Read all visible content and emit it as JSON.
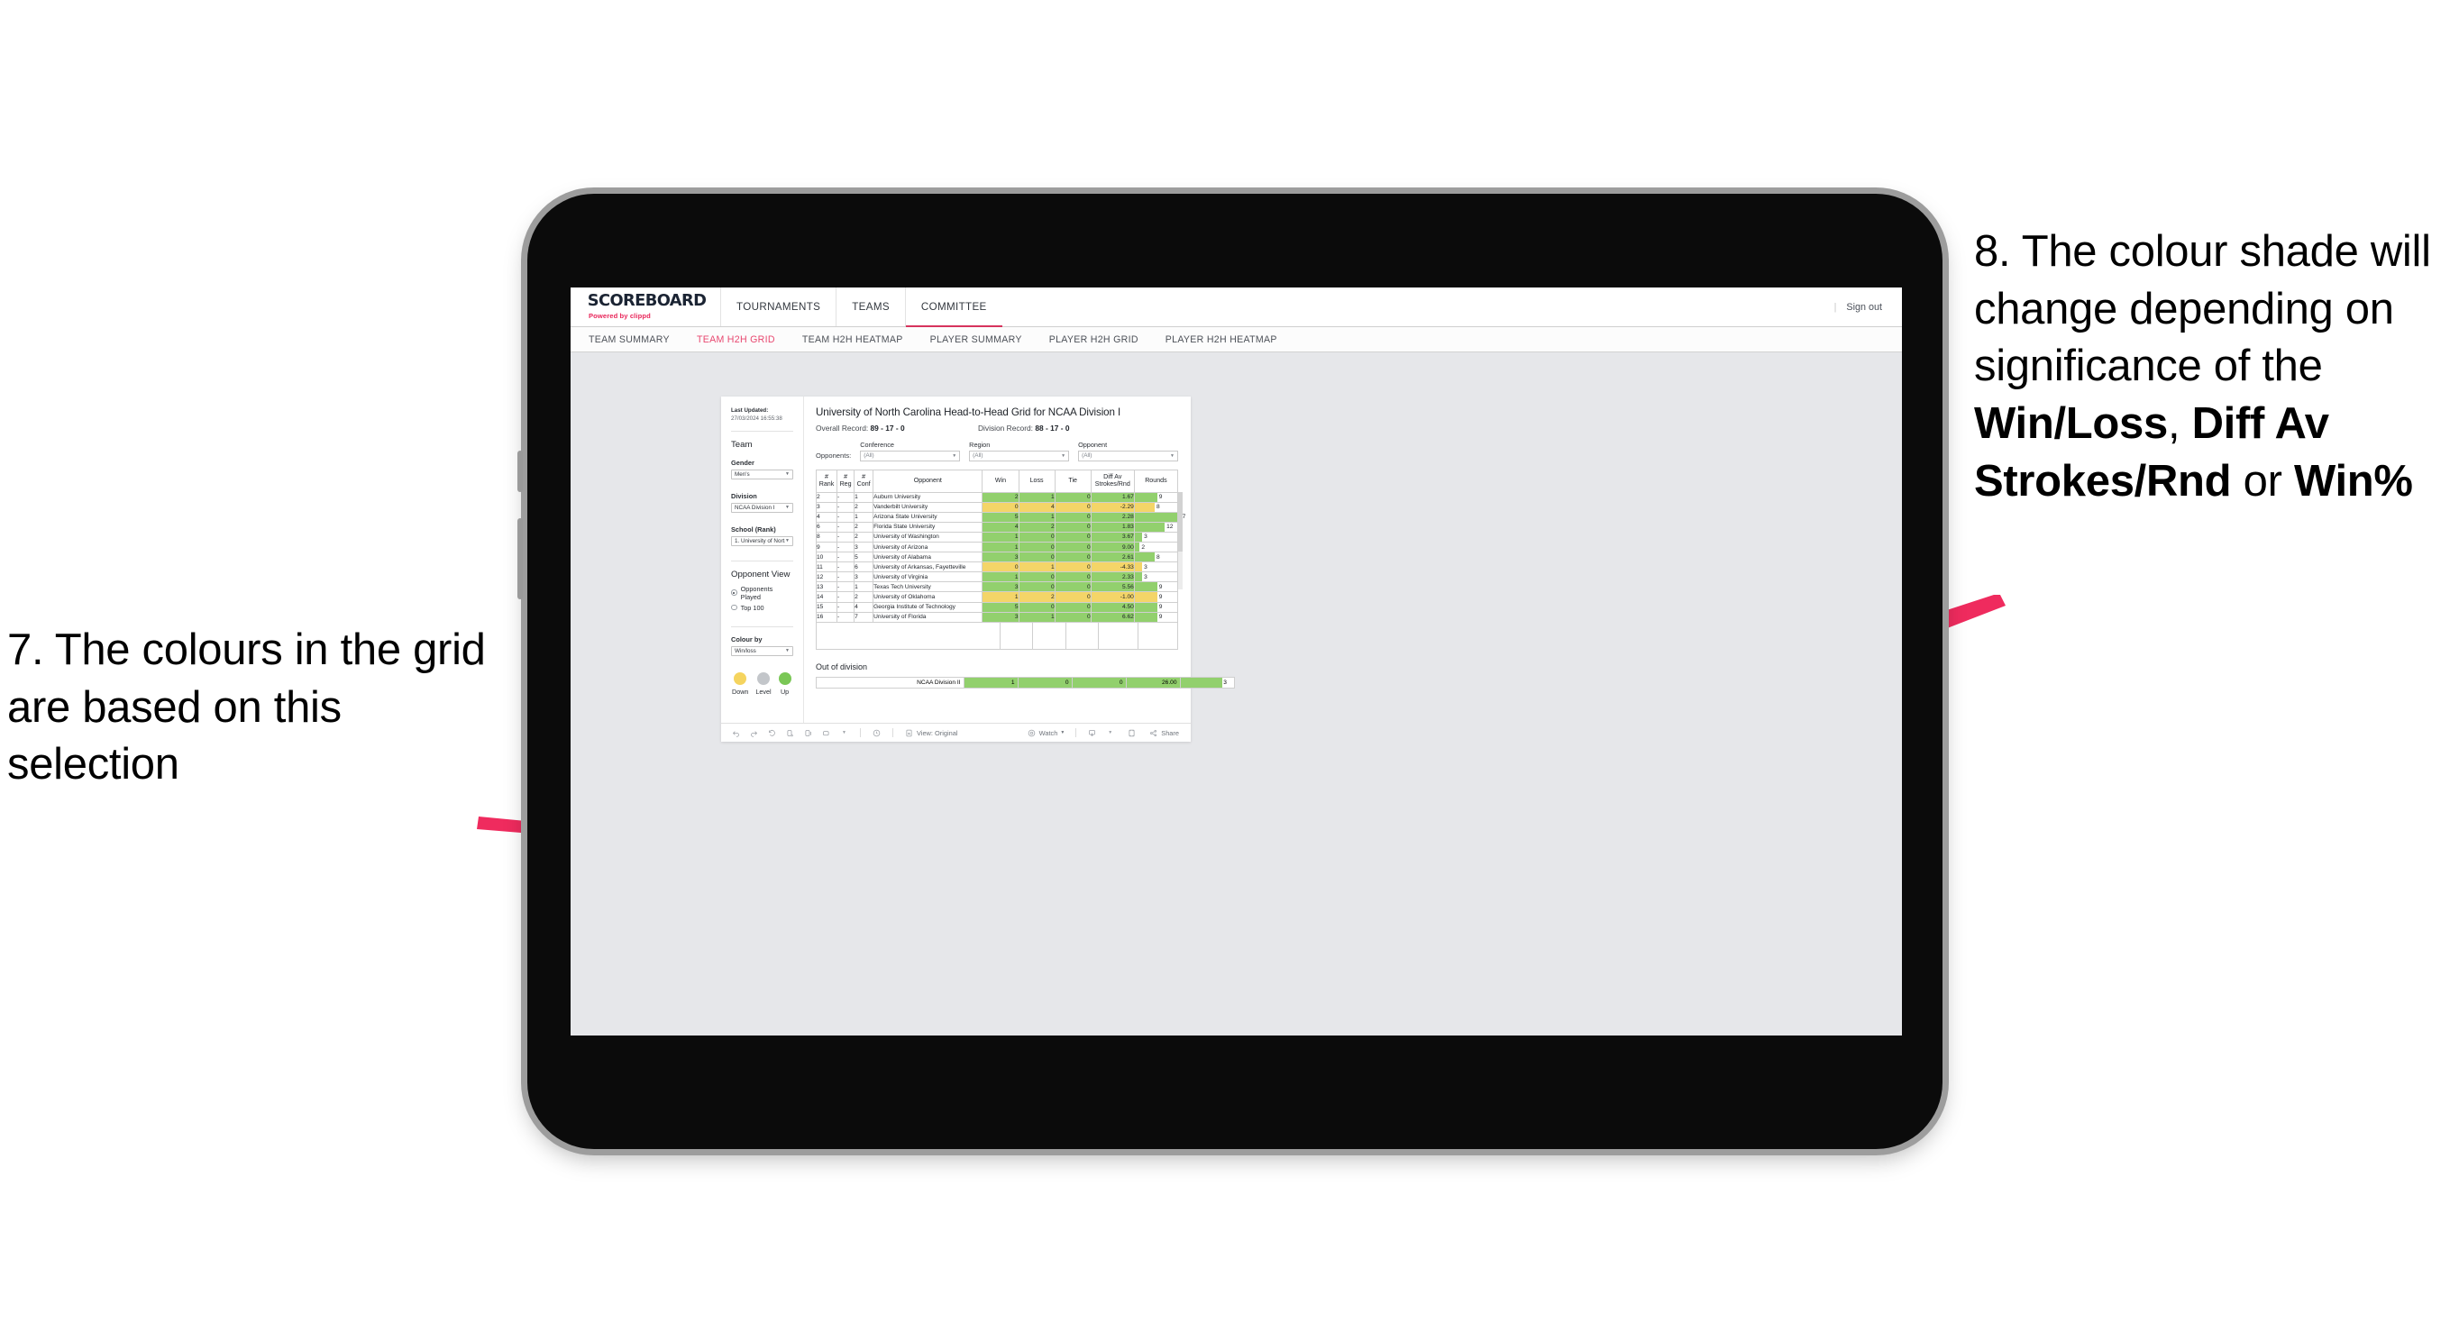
{
  "annotations": {
    "left": {
      "id": "callout-7",
      "text": "7. The colours in the grid are based on this selection"
    },
    "right": {
      "id": "callout-8",
      "pre": "8. The colour shade will change depending on significance of the ",
      "bold1": "Win/Loss",
      "mid1": ", ",
      "bold2": "Diff Av Strokes/Rnd",
      "mid2": " or ",
      "bold3": "Win%"
    },
    "arrow_color": "#ef2b5e"
  },
  "app": {
    "brand": {
      "name": "SCOREBOARD",
      "powered_by": "Powered by",
      "vendor": "clippd"
    },
    "top_nav": [
      {
        "label": "TOURNAMENTS",
        "active": false
      },
      {
        "label": "TEAMS",
        "active": false
      },
      {
        "label": "COMMITTEE",
        "active": true
      }
    ],
    "sign_out": "Sign out",
    "sub_nav": [
      {
        "label": "TEAM SUMMARY",
        "active": false
      },
      {
        "label": "TEAM H2H GRID",
        "active": true
      },
      {
        "label": "TEAM H2H HEATMAP",
        "active": false
      },
      {
        "label": "PLAYER SUMMARY",
        "active": false
      },
      {
        "label": "PLAYER H2H GRID",
        "active": false
      },
      {
        "label": "PLAYER H2H HEATMAP",
        "active": false
      }
    ],
    "accent_color": "#e8476f"
  },
  "filters": {
    "last_updated_label": "Last Updated:",
    "last_updated_value": "27/03/2024 16:55:38",
    "team_heading": "Team",
    "gender": {
      "label": "Gender",
      "value": "Men's"
    },
    "division": {
      "label": "Division",
      "value": "NCAA Division I"
    },
    "school": {
      "label": "School (Rank)",
      "value": "1. University of Nort..."
    },
    "opponent_view": {
      "heading": "Opponent View",
      "options": [
        {
          "label": "Opponents Played",
          "selected": true
        },
        {
          "label": "Top 100",
          "selected": false
        }
      ]
    },
    "colour_by": {
      "label": "Colour by",
      "value": "Win/loss"
    },
    "legend": [
      {
        "label": "Down",
        "color": "#f5d45f"
      },
      {
        "label": "Level",
        "color": "#c3c6ca"
      },
      {
        "label": "Up",
        "color": "#7ac756"
      }
    ]
  },
  "report": {
    "title": "University of North Carolina Head-to-Head Grid for NCAA Division I",
    "overall_record_label": "Overall Record:",
    "overall_record_value": "89 - 17 - 0",
    "division_record_label": "Division Record:",
    "division_record_value": "88 - 17 - 0",
    "opponents_label": "Opponents:",
    "opponent_filters": [
      {
        "label": "Conference",
        "value": "(All)"
      },
      {
        "label": "Region",
        "value": "(All)"
      },
      {
        "label": "Opponent",
        "value": "(All)"
      }
    ]
  },
  "chart_data": {
    "type": "table",
    "title": "University of North Carolina Head-to-Head Grid for NCAA Division I",
    "colour_by": "Win/loss",
    "columns": [
      "# Rank",
      "# Reg",
      "# Conf",
      "Opponent",
      "Win",
      "Loss",
      "Tie",
      "Diff Av Strokes/Rnd",
      "Rounds"
    ],
    "column_headers_multiline": [
      {
        "l1": "#",
        "l2": "Rank"
      },
      {
        "l1": "#",
        "l2": "Reg"
      },
      {
        "l1": "#",
        "l2": "Conf"
      },
      {
        "l1": "",
        "l2": "Opponent"
      },
      {
        "l1": "",
        "l2": "Win"
      },
      {
        "l1": "",
        "l2": "Loss"
      },
      {
        "l1": "",
        "l2": "Tie"
      },
      {
        "l1": "Diff Av",
        "l2": "Strokes/Rnd"
      },
      {
        "l1": "",
        "l2": "Rounds"
      }
    ],
    "rounds_axis_max": 17,
    "colors": {
      "up": "#92d06d",
      "down": "#f4d568",
      "level": "#c3c6ca"
    },
    "rows": [
      {
        "rank": "2",
        "reg": "-",
        "conf": "1",
        "opponent": "Auburn University",
        "win": "2",
        "loss": "1",
        "tie": "0",
        "diff": "1.67",
        "rounds": "9",
        "state": "up"
      },
      {
        "rank": "3",
        "reg": "-",
        "conf": "2",
        "opponent": "Vanderbilt University",
        "win": "0",
        "loss": "4",
        "tie": "0",
        "diff": "-2.29",
        "rounds": "8",
        "state": "down"
      },
      {
        "rank": "4",
        "reg": "-",
        "conf": "1",
        "opponent": "Arizona State University",
        "win": "5",
        "loss": "1",
        "tie": "0",
        "diff": "2.28",
        "rounds": "17",
        "state": "up"
      },
      {
        "rank": "6",
        "reg": "-",
        "conf": "2",
        "opponent": "Florida State University",
        "win": "4",
        "loss": "2",
        "tie": "0",
        "diff": "1.83",
        "rounds": "12",
        "state": "up"
      },
      {
        "rank": "8",
        "reg": "-",
        "conf": "2",
        "opponent": "University of Washington",
        "win": "1",
        "loss": "0",
        "tie": "0",
        "diff": "3.67",
        "rounds": "3",
        "state": "up"
      },
      {
        "rank": "9",
        "reg": "-",
        "conf": "3",
        "opponent": "University of Arizona",
        "win": "1",
        "loss": "0",
        "tie": "0",
        "diff": "9.00",
        "rounds": "2",
        "state": "up"
      },
      {
        "rank": "10",
        "reg": "-",
        "conf": "5",
        "opponent": "University of Alabama",
        "win": "3",
        "loss": "0",
        "tie": "0",
        "diff": "2.61",
        "rounds": "8",
        "state": "up"
      },
      {
        "rank": "11",
        "reg": "-",
        "conf": "6",
        "opponent": "University of Arkansas, Fayetteville",
        "win": "0",
        "loss": "1",
        "tie": "0",
        "diff": "-4.33",
        "rounds": "3",
        "state": "down"
      },
      {
        "rank": "12",
        "reg": "-",
        "conf": "3",
        "opponent": "University of Virginia",
        "win": "1",
        "loss": "0",
        "tie": "0",
        "diff": "2.33",
        "rounds": "3",
        "state": "up"
      },
      {
        "rank": "13",
        "reg": "-",
        "conf": "1",
        "opponent": "Texas Tech University",
        "win": "3",
        "loss": "0",
        "tie": "0",
        "diff": "5.56",
        "rounds": "9",
        "state": "up"
      },
      {
        "rank": "14",
        "reg": "-",
        "conf": "2",
        "opponent": "University of Oklahoma",
        "win": "1",
        "loss": "2",
        "tie": "0",
        "diff": "-1.00",
        "rounds": "9",
        "state": "down"
      },
      {
        "rank": "15",
        "reg": "-",
        "conf": "4",
        "opponent": "Georgia Institute of Technology",
        "win": "5",
        "loss": "0",
        "tie": "0",
        "diff": "4.50",
        "rounds": "9",
        "state": "up"
      },
      {
        "rank": "16",
        "reg": "-",
        "conf": "7",
        "opponent": "University of Florida",
        "win": "3",
        "loss": "1",
        "tie": "0",
        "diff": "6.62",
        "rounds": "9",
        "state": "up"
      }
    ]
  },
  "out_of_division": {
    "title": "Out of division",
    "row": {
      "name": "NCAA Division II",
      "win": "1",
      "loss": "0",
      "tie": "0",
      "diff": "26.00",
      "rounds": "3",
      "state": "up"
    }
  },
  "toolbar": {
    "undo": "undo-icon",
    "redo": "redo-icon",
    "revert": "revert-icon",
    "refresh": "refresh-icon",
    "pause": "pause-icon",
    "highlight": "highlight-icon",
    "view_label": "View: Original",
    "watch_label": "Watch",
    "share_label": "Share"
  }
}
